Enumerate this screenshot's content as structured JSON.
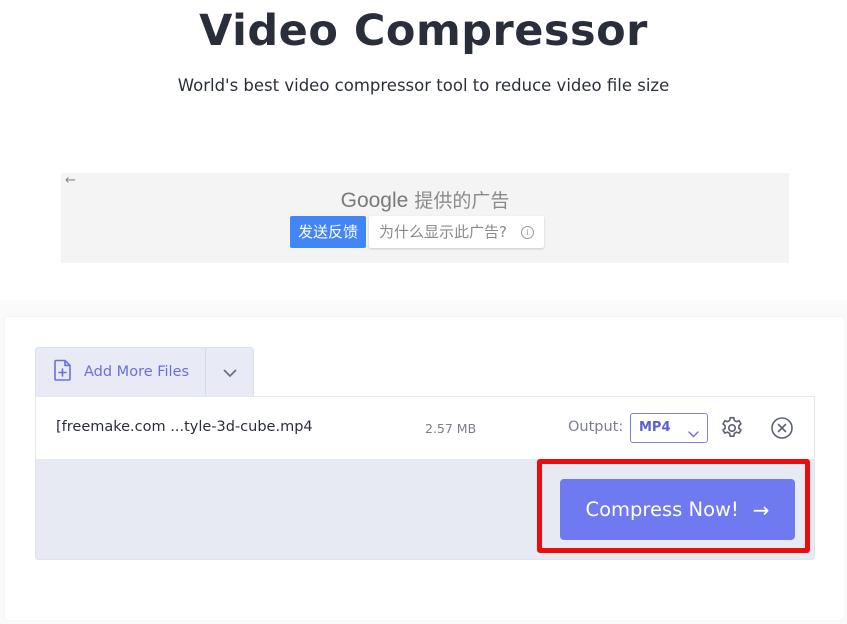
{
  "header": {
    "title": "Video Compressor",
    "subtitle": "World's best video compressor tool to reduce video file size"
  },
  "ad": {
    "back_icon": "←",
    "brand": "Google",
    "provided_by": "提供的广告",
    "feedback_button": "发送反馈",
    "why_button": "为什么显示此广告?",
    "info_icon": "i"
  },
  "uploader": {
    "add_files_label": "Add More Files",
    "file": {
      "name": "[freemake.com ...tyle-3d-cube.mp4",
      "size": "2.57 MB",
      "output_label": "Output:",
      "output_format": "MP4"
    },
    "compress_button": "Compress Now!",
    "compress_arrow": "→"
  },
  "colors": {
    "accent": "#6f79f0",
    "highlight": "#ee0b0b",
    "ad_button": "#4285f4"
  }
}
